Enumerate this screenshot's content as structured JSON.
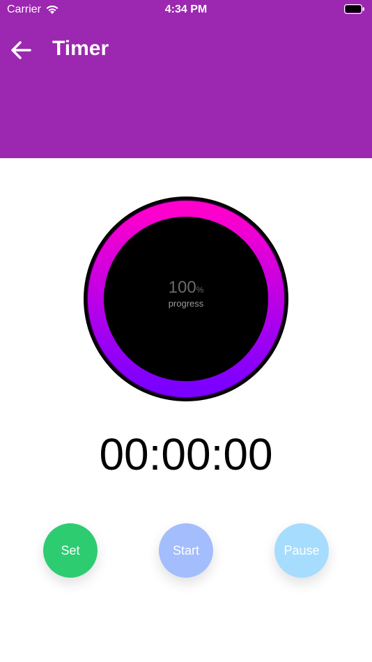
{
  "status_bar": {
    "carrier": "Carrier",
    "time": "4:34 PM"
  },
  "header": {
    "title": "Timer",
    "background_color": "#9c27b0"
  },
  "progress": {
    "value": "100",
    "unit": "%",
    "label": "progress",
    "fraction": 1.0,
    "gradient_start": "#7b00ff",
    "gradient_end": "#ff00cc"
  },
  "timer": {
    "display": "00:00:00"
  },
  "controls": {
    "set_label": "Set",
    "start_label": "Start",
    "pause_label": "Pause",
    "set_color": "#2ecc71",
    "start_color": "#a3bdfd",
    "pause_color": "#a6dcfd"
  }
}
